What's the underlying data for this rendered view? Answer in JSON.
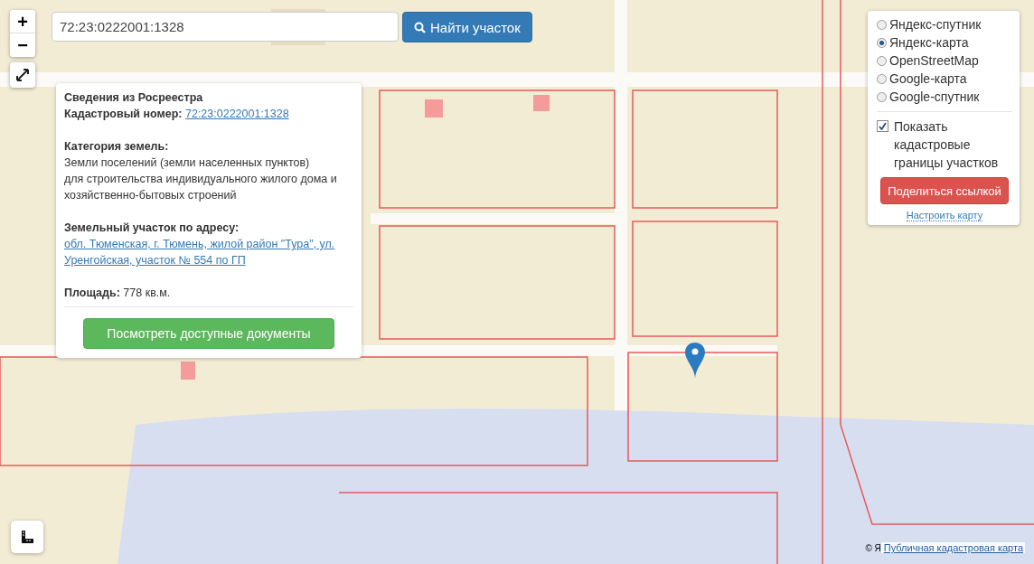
{
  "map_controls": {
    "zoom_in": "+",
    "zoom_out": "−"
  },
  "search": {
    "value": "72:23:0222001:1328",
    "button": "Найти участок"
  },
  "info_popup": {
    "title": "Сведения из Росреестра",
    "cadastral_label": "Кадастровый номер:",
    "cadastral_number": "72:23:0222001:1328",
    "category_label": "Категория земель:",
    "category_lines": [
      "Земли поселений (земли населенных пунктов)",
      "для строительства индивидуального жилого дома и",
      "хозяйственно-бытовых строений"
    ],
    "address_label": "Земельный участок по адресу:",
    "address": "обл. Тюменская, г. Тюмень, жилой район \"Тура\", ул. Уренгойская, участок № 554 по ГП",
    "area_label": "Площадь:",
    "area_value": "778 кв.м.",
    "button": "Посмотреть доступные документы"
  },
  "layers": [
    {
      "label": "Яндекс-спутник",
      "selected": false
    },
    {
      "label": "Яндекс-карта",
      "selected": true
    },
    {
      "label": "OpenStreetMap",
      "selected": false
    },
    {
      "label": "Google-карта",
      "selected": false
    },
    {
      "label": "Google-спутник",
      "selected": false
    }
  ],
  "cadastral_borders": {
    "label": "Показать кадастровые границы участков",
    "checked": true
  },
  "share_button": "Поделиться ссылкой",
  "configure_link": "Настроить карту",
  "attribution": {
    "text": "© Я",
    "link": "Публичная кадастровая карта"
  }
}
